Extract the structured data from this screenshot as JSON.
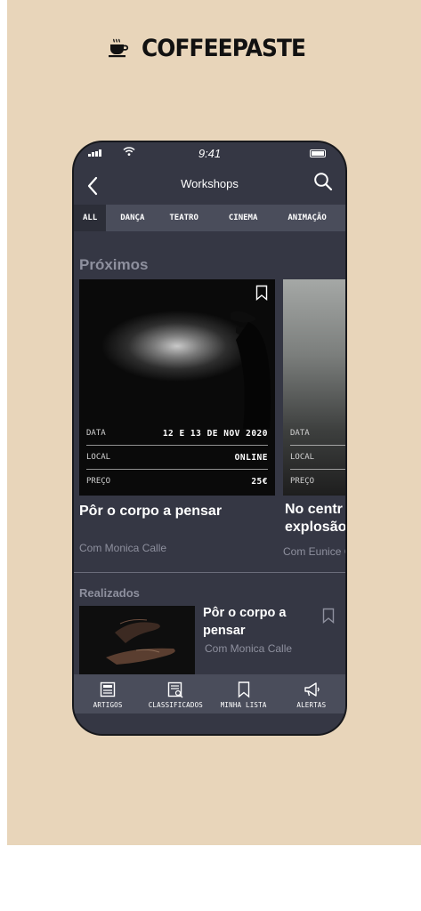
{
  "brand": {
    "name": "COFFEEPASTE",
    "icon": "coffee-cup-icon"
  },
  "status_bar": {
    "time": "9:41"
  },
  "header": {
    "title": "Workshops",
    "back_icon": "chevron-left-icon",
    "search_icon": "search-icon"
  },
  "tabs": [
    {
      "label": "ALL",
      "active": true
    },
    {
      "label": "DANÇA",
      "active": false
    },
    {
      "label": "TEATRO",
      "active": false
    },
    {
      "label": "CINEMA",
      "active": false
    },
    {
      "label": "ANIMAÇÃO",
      "active": false
    }
  ],
  "upcoming": {
    "section_title": "Próximos",
    "cards": [
      {
        "title": "Pôr o corpo a pensar",
        "author": "Com Monica Calle",
        "rows": [
          {
            "label": "DATA",
            "value": "12 E 13 DE NOV 2020"
          },
          {
            "label": "LOCAL",
            "value": "ONLINE"
          },
          {
            "label": "PREÇO",
            "value": "25€"
          }
        ]
      },
      {
        "title": "No centro da explosão",
        "title_visible": "No centr\nexplosão",
        "author": "Com Eunice C",
        "rows": [
          {
            "label": "DATA",
            "value": ""
          },
          {
            "label": "LOCAL",
            "value": ""
          },
          {
            "label": "PREÇO",
            "value": ""
          }
        ]
      }
    ]
  },
  "past": {
    "section_title": "Realizados",
    "items": [
      {
        "title": "Pôr o corpo a pensar",
        "author": "Com Monica Calle"
      }
    ]
  },
  "bottom_nav": [
    {
      "label": "ARTIGOS",
      "icon": "articles-icon"
    },
    {
      "label": "CLASSIFICADOS",
      "icon": "classifieds-icon"
    },
    {
      "label": "MINHA LISTA",
      "icon": "bookmark-icon"
    },
    {
      "label": "ALERTAS",
      "icon": "megaphone-icon"
    }
  ],
  "colors": {
    "background": "#e8d5ba",
    "screen": "#353744",
    "tab_bar": "#4a4d5b",
    "muted_text": "#8e909e"
  }
}
